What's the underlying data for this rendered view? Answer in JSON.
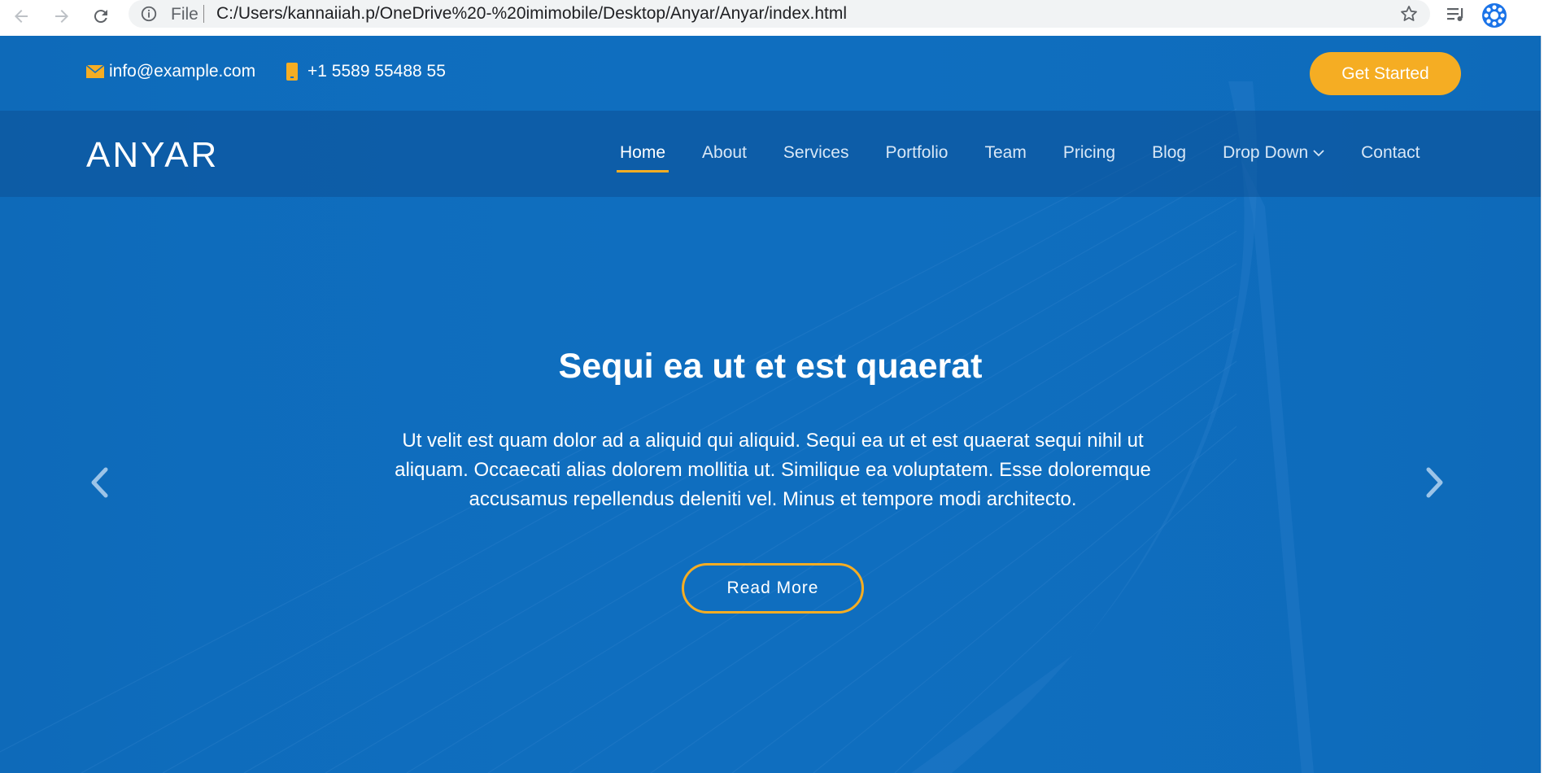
{
  "browser": {
    "file_label": "File",
    "url": "C:/Users/kannaiiah.p/OneDrive%20-%20imimobile/Desktop/Anyar/Anyar/index.html",
    "icons": [
      "back-arrow-icon",
      "forward-arrow-icon",
      "reload-icon",
      "info-icon",
      "star-icon",
      "media-icon",
      "extension-icon"
    ]
  },
  "topbar": {
    "email": "info@example.com",
    "phone": "+1 5589 55488 55",
    "cta_label": "Get Started"
  },
  "header": {
    "logo": "ANYAR",
    "nav": [
      {
        "label": "Home",
        "active": true
      },
      {
        "label": "About"
      },
      {
        "label": "Services"
      },
      {
        "label": "Portfolio"
      },
      {
        "label": "Team"
      },
      {
        "label": "Pricing"
      },
      {
        "label": "Blog"
      },
      {
        "label": "Drop Down",
        "has_dropdown": true
      },
      {
        "label": "Contact"
      }
    ]
  },
  "hero": {
    "title": "Sequi ea ut et est quaerat",
    "text": "Ut velit est quam dolor ad a aliquid qui aliquid. Sequi ea ut et est quaerat sequi nihil ut aliquam. Occaecati alias dolorem mollitia ut. Similique ea voluptatem. Esse doloremque accusamus repellendus deleniti vel. Minus et tempore modi architecto.",
    "button_label": "Read More"
  },
  "colors": {
    "primary_blue": "#0f6ebf",
    "accent": "#f5ad23",
    "white": "#ffffff"
  }
}
